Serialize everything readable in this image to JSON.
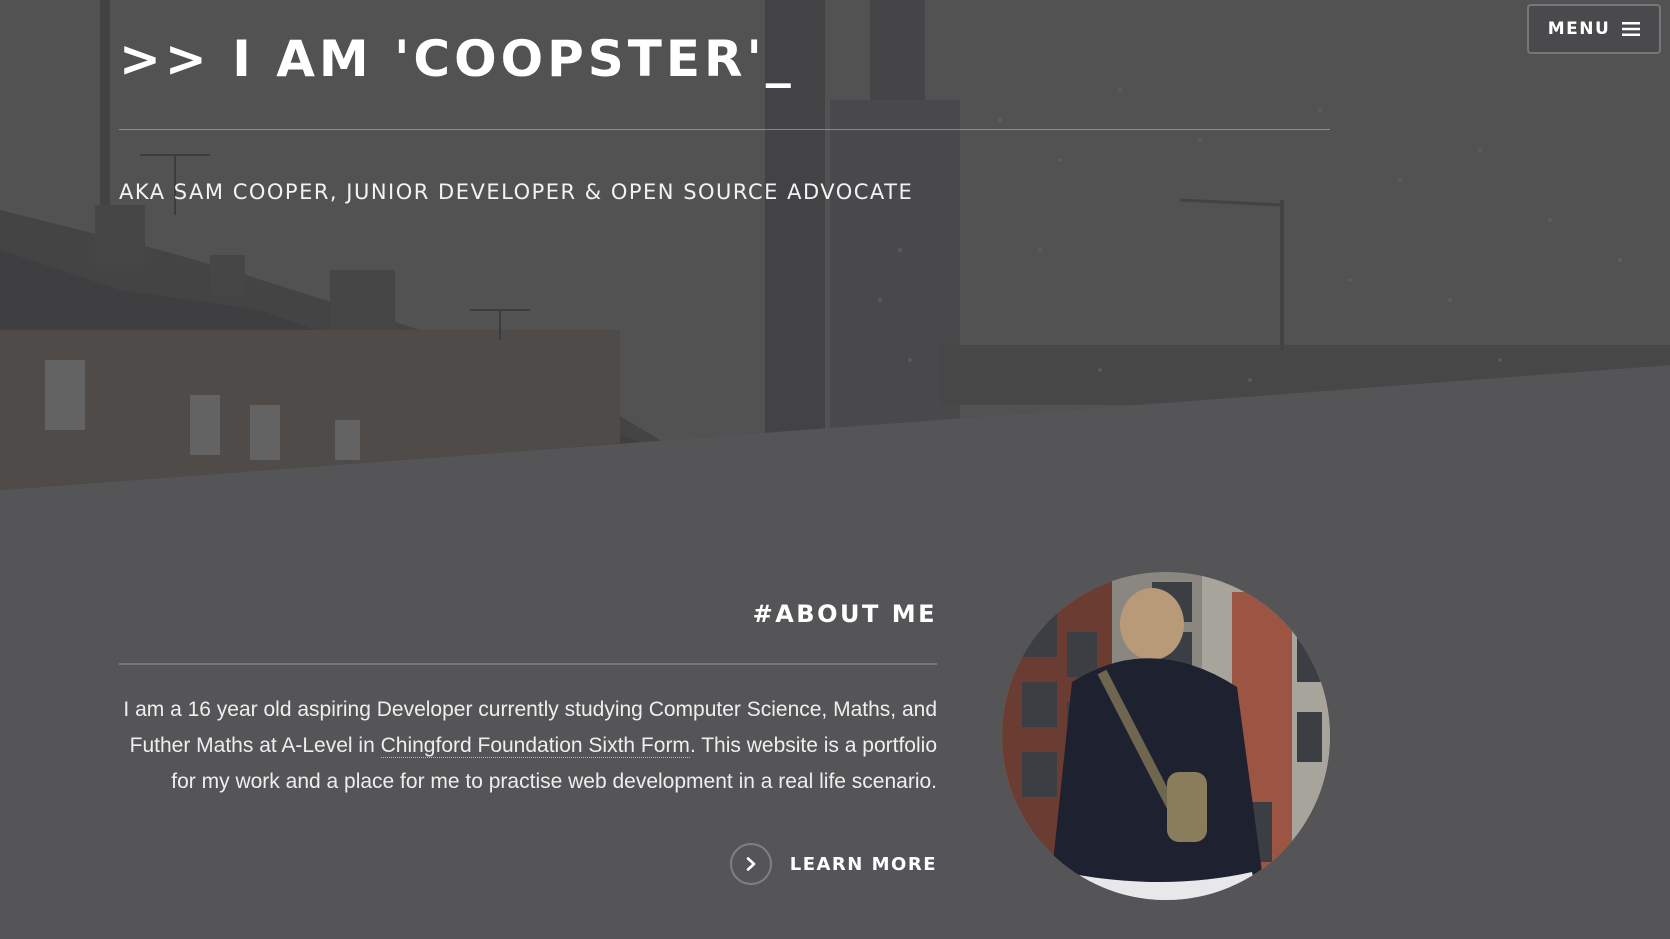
{
  "hero": {
    "title": ">> I AM 'COOPSTER'_",
    "subtitle": "AKA SAM COOPER, JUNIOR DEVELOPER & OPEN SOURCE ADVOCATE"
  },
  "menu": {
    "label": "MENU",
    "icon": "hamburger-icon"
  },
  "about": {
    "heading": "#ABOUT ME",
    "text_before_link": "I am a 16 year old aspiring Developer currently studying Computer Science, Maths, and Futher Maths at A-Level in ",
    "link_text": "Chingford Foundation Sixth Form",
    "text_after_link": ". This website is a portfolio for my work and a place for me to practise web development in a real life scenario.",
    "learn_more_label": "LEARN MORE",
    "learn_more_icon": "chevron-right-icon"
  },
  "colors": {
    "background": "#555557",
    "text": "#ffffff"
  }
}
